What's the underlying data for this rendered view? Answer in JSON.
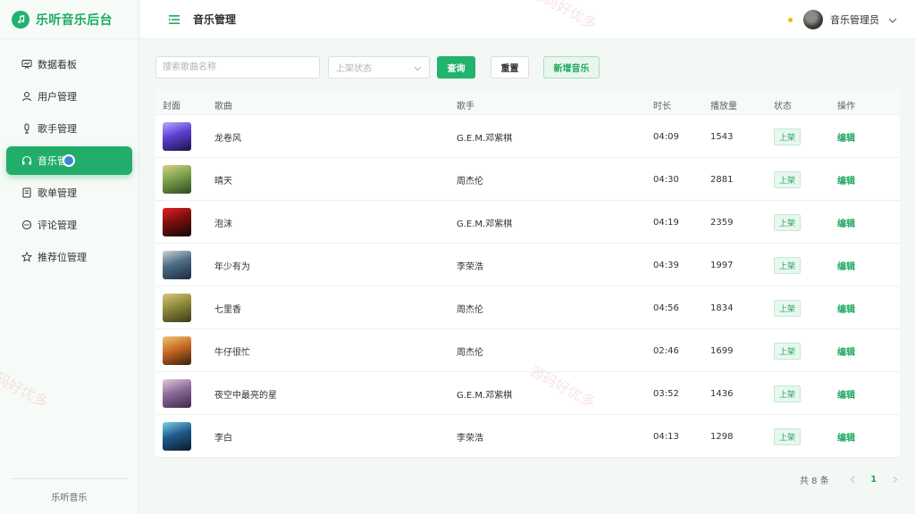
{
  "app": {
    "title": "乐听音乐后台"
  },
  "sidebar": {
    "items": [
      {
        "label": "数据看板",
        "icon": "dashboard-icon"
      },
      {
        "label": "用户管理",
        "icon": "user-icon"
      },
      {
        "label": "歌手管理",
        "icon": "microphone-icon"
      },
      {
        "label": "音乐管",
        "icon": "headphones-icon",
        "active": true
      },
      {
        "label": "歌单管理",
        "icon": "playlist-icon"
      },
      {
        "label": "评论管理",
        "icon": "comment-icon"
      },
      {
        "label": "推荐位管理",
        "icon": "star-icon"
      }
    ],
    "footer": "乐听音乐"
  },
  "header": {
    "title": "音乐管理",
    "user_name": "音乐管理员"
  },
  "filters": {
    "search_placeholder": "搜索歌曲名称",
    "status_placeholder": "上架状态",
    "query_label": "查询",
    "reset_label": "重置",
    "add_label": "新增音乐"
  },
  "table": {
    "columns": [
      "封面",
      "歌曲",
      "歌手",
      "时长",
      "播放量",
      "状态",
      "操作"
    ],
    "rows": [
      {
        "song": "龙卷风",
        "artist": "G.E.M.邓紫棋",
        "duration": "04:09",
        "plays": "1543",
        "status": "上架",
        "action": "编辑",
        "cover": [
          "#1b1440",
          "#5a3fd0",
          "#b7a8ff"
        ]
      },
      {
        "song": "晴天",
        "artist": "周杰伦",
        "duration": "04:30",
        "plays": "2881",
        "status": "上架",
        "action": "编辑",
        "cover": [
          "#2d4a22",
          "#7ba04a",
          "#d8d08a"
        ]
      },
      {
        "song": "泡沫",
        "artist": "G.E.M.邓紫棋",
        "duration": "04:19",
        "plays": "2359",
        "status": "上架",
        "action": "编辑",
        "cover": [
          "#120707",
          "#7a0e0e",
          "#e32222"
        ]
      },
      {
        "song": "年少有为",
        "artist": "李荣浩",
        "duration": "04:39",
        "plays": "1997",
        "status": "上架",
        "action": "编辑",
        "cover": [
          "#1c2c3c",
          "#4b6b85",
          "#c9d2d6"
        ]
      },
      {
        "song": "七里香",
        "artist": "周杰伦",
        "duration": "04:56",
        "plays": "1834",
        "status": "上架",
        "action": "编辑",
        "cover": [
          "#3b3a18",
          "#8d8a3a",
          "#d9c77a"
        ]
      },
      {
        "song": "牛仔很忙",
        "artist": "周杰伦",
        "duration": "02:46",
        "plays": "1699",
        "status": "上架",
        "action": "编辑",
        "cover": [
          "#3a1e0e",
          "#c86a22",
          "#f2c27a"
        ]
      },
      {
        "song": "夜空中最亮的星",
        "artist": "G.E.M.邓紫棋",
        "duration": "03:52",
        "plays": "1436",
        "status": "上架",
        "action": "编辑",
        "cover": [
          "#3a2a44",
          "#8a6a9a",
          "#e2c9d8"
        ]
      },
      {
        "song": "李白",
        "artist": "李荣浩",
        "duration": "04:13",
        "plays": "1298",
        "status": "上架",
        "action": "编辑",
        "cover": [
          "#0c1a2a",
          "#1e5a8a",
          "#7ad0e8"
        ]
      }
    ]
  },
  "pagination": {
    "total_text": "共 8 条",
    "current_page": "1"
  },
  "watermark": "源码好优多",
  "colors": {
    "accent": "#22b36c",
    "active_dot": "#3d86d6",
    "notify": "#f5b800"
  }
}
